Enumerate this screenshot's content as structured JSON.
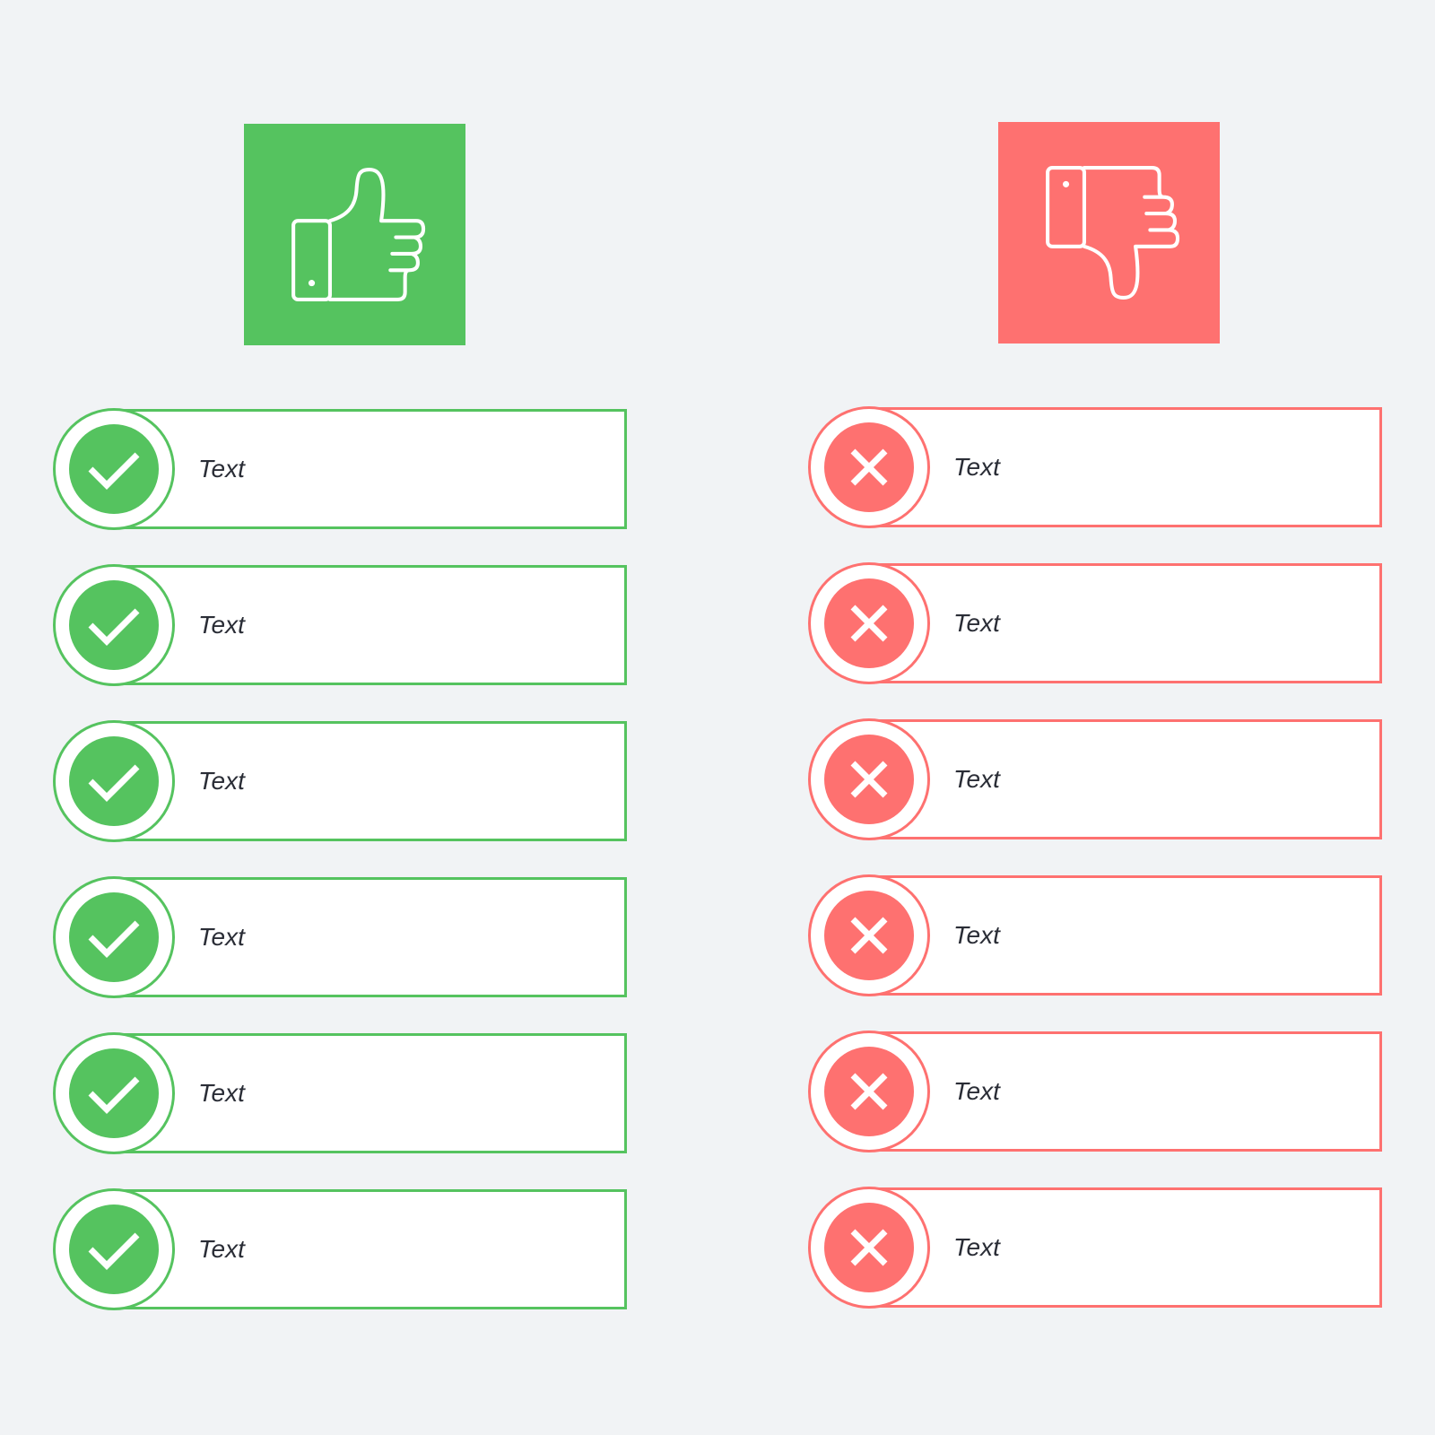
{
  "colors": {
    "positive": "#55c35f",
    "negative": "#fe7170",
    "background": "#f1f3f5"
  },
  "positive": {
    "icon": "thumbs-up-icon",
    "items": [
      {
        "label": "Text"
      },
      {
        "label": "Text"
      },
      {
        "label": "Text"
      },
      {
        "label": "Text"
      },
      {
        "label": "Text"
      },
      {
        "label": "Text"
      }
    ]
  },
  "negative": {
    "icon": "thumbs-down-icon",
    "items": [
      {
        "label": "Text"
      },
      {
        "label": "Text"
      },
      {
        "label": "Text"
      },
      {
        "label": "Text"
      },
      {
        "label": "Text"
      },
      {
        "label": "Text"
      }
    ]
  }
}
